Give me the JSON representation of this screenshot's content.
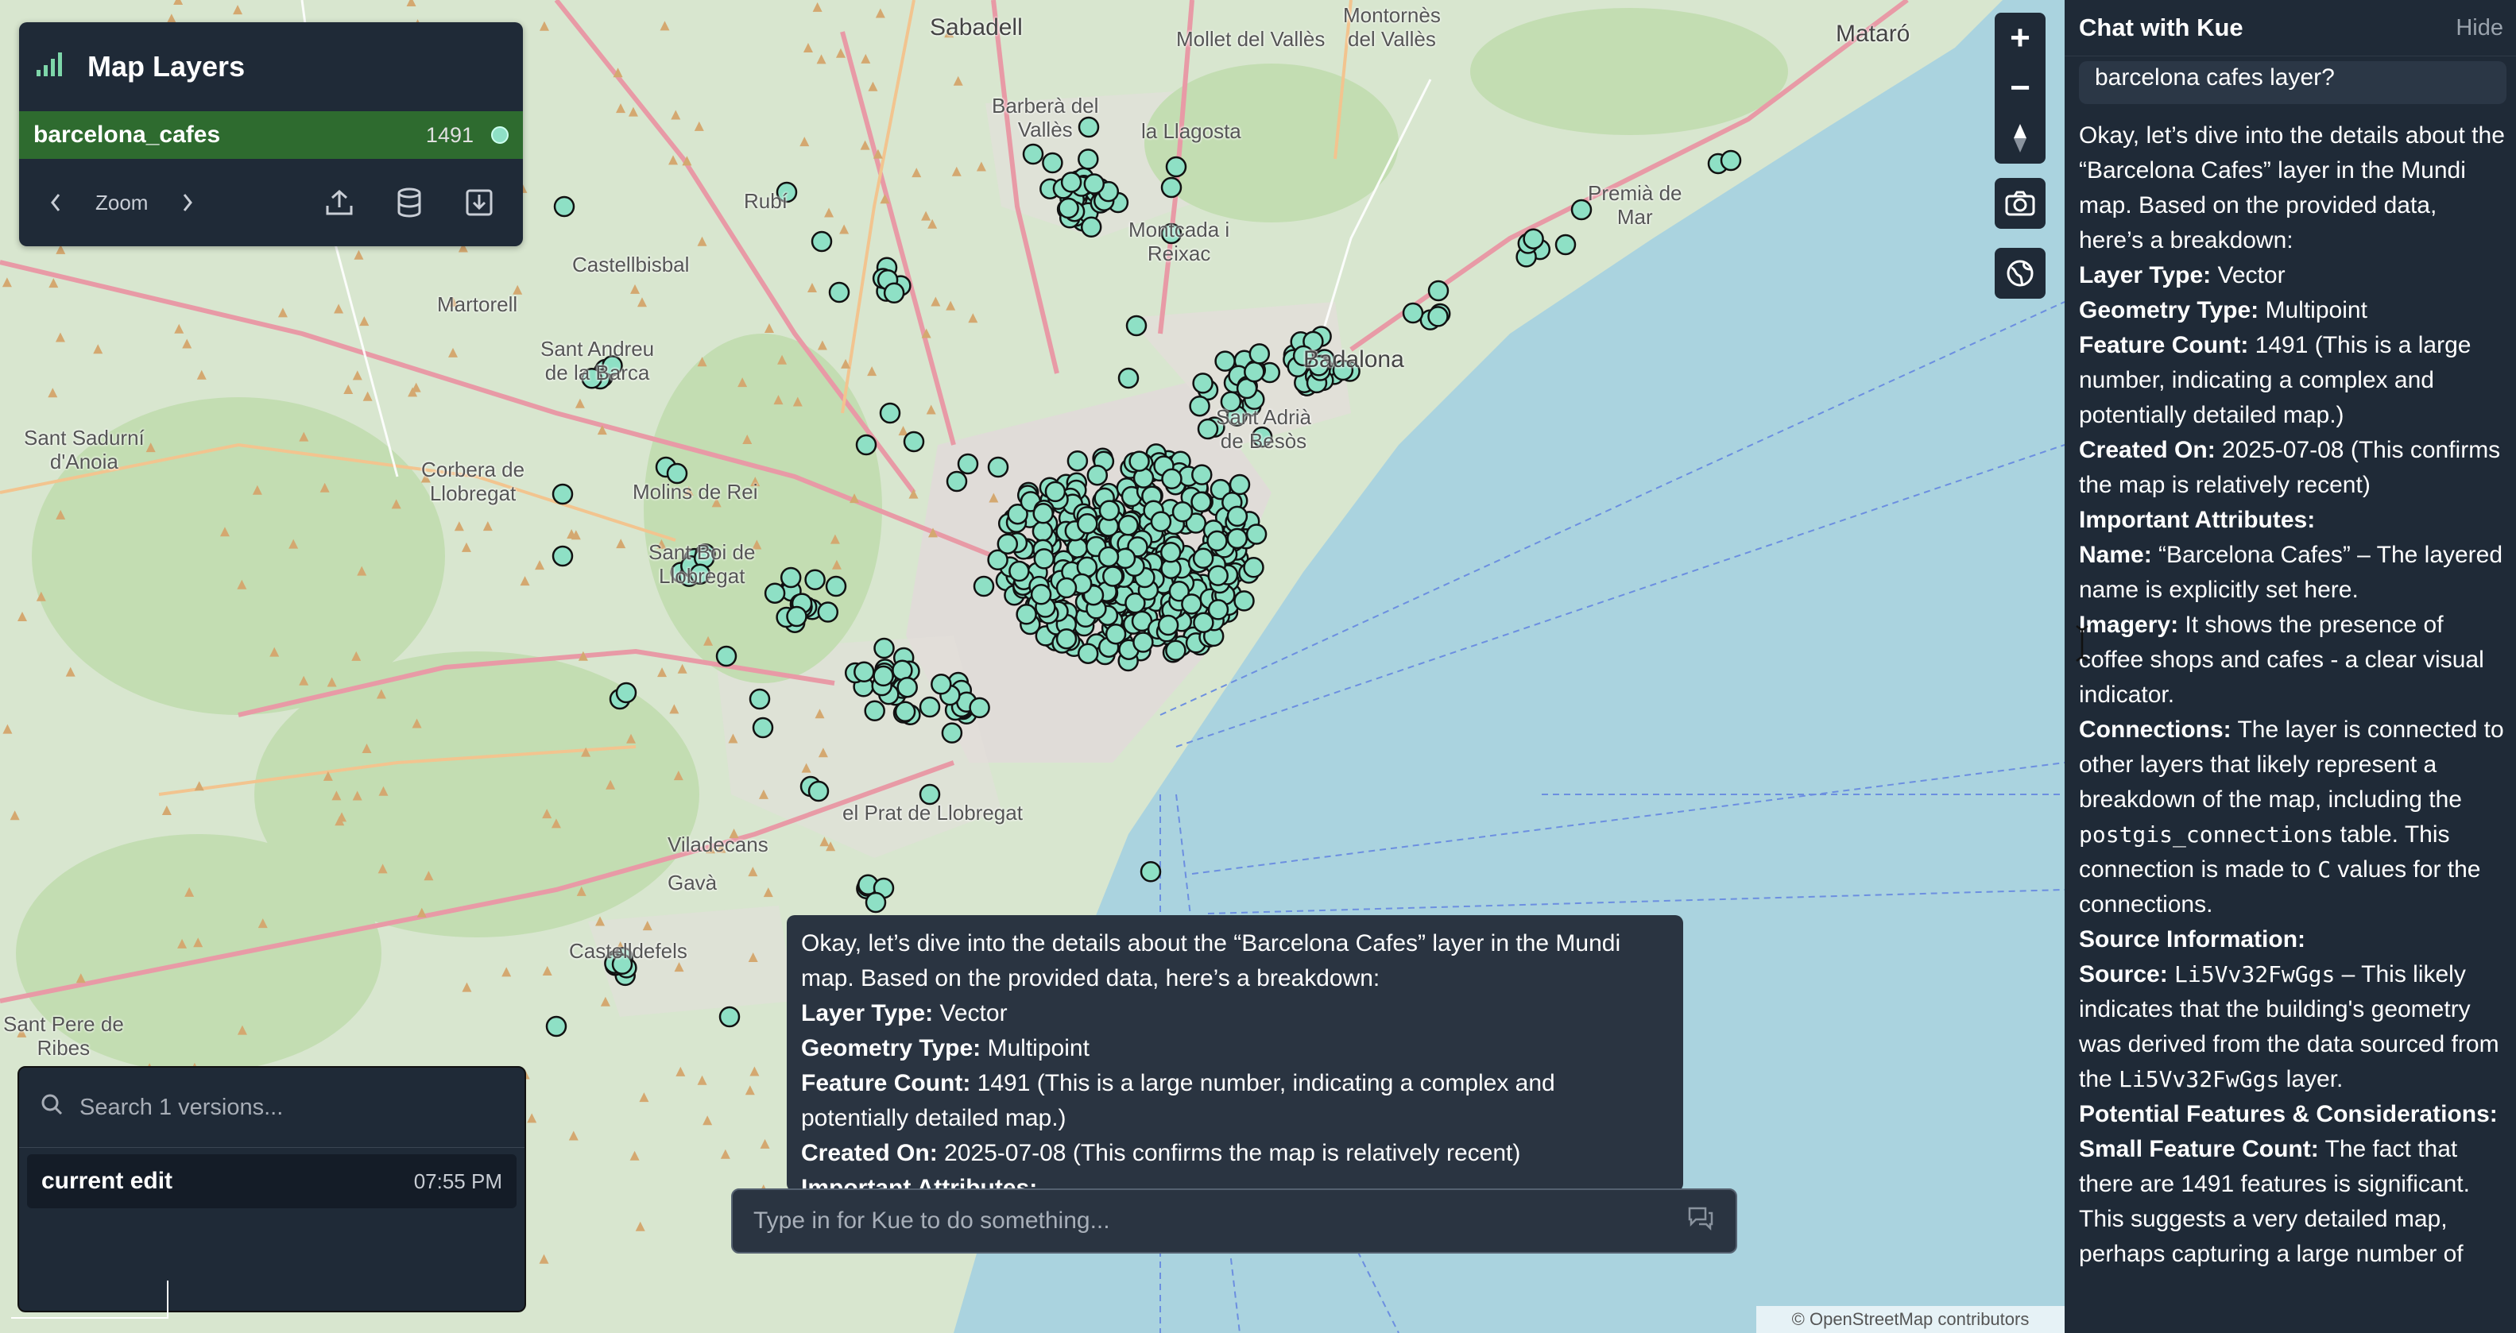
{
  "map": {
    "places": [
      {
        "name": "Sabadell"
      },
      {
        "name": "Montornès\ndel Vallès"
      },
      {
        "name": "Mollet del Vallès"
      },
      {
        "name": "Mataró"
      },
      {
        "name": "Barberà del\nVallès"
      },
      {
        "name": "la Llagosta"
      },
      {
        "name": "Rubí"
      },
      {
        "name": "Montcada i\nReixac"
      },
      {
        "name": "Premià de\nMar"
      },
      {
        "name": "Martorell"
      },
      {
        "name": "Castellbisbal"
      },
      {
        "name": "Sant Andreu\nde la Barca"
      },
      {
        "name": "Badalona"
      },
      {
        "name": "Sant Adrià\nde Besòs"
      },
      {
        "name": "Sant Sadurní\nd'Anoia"
      },
      {
        "name": "Corbera de\nLlobregat"
      },
      {
        "name": "Molins de Rei"
      },
      {
        "name": "Sant Boi de\nLlobregat"
      },
      {
        "name": "Viladecans"
      },
      {
        "name": "el Prat de Llobregat"
      },
      {
        "name": "Gavà"
      },
      {
        "name": "Castelldefels"
      },
      {
        "name": "Sant Pere de\nRibes"
      }
    ],
    "marker_color": "#8ee0c5",
    "attribution": "© OpenStreetMap contributors"
  },
  "layers_panel": {
    "title": "Map Layers",
    "layer": {
      "name": "barcelona_cafes",
      "count": "1491",
      "color": "#2e6b2f"
    },
    "zoom_label": "Zoom"
  },
  "map_controls": {
    "zoom_in": "+",
    "zoom_out": "−"
  },
  "versions": {
    "search_placeholder": "Search 1 versions...",
    "items": [
      {
        "label": "current edit",
        "time": "07:55 PM"
      }
    ]
  },
  "popup": {
    "intro": "Okay, let’s dive into the details about the “Barcelona Cafes” layer in the Mundi map. Based on the provided data, here’s a breakdown:",
    "rows": [
      {
        "key": "Layer Type:",
        "val": " Vector"
      },
      {
        "key": "Geometry Type:",
        "val": " Multipoint"
      },
      {
        "key": "Feature Count:",
        "val": " 1491 (This is a large number, indicating a complex and potentially detailed map.)"
      },
      {
        "key": "Created On:",
        "val": " 2025-07-08 (This confirms the map is relatively recent)"
      },
      {
        "key": "Important Attributes:",
        "val": ""
      }
    ]
  },
  "prompt": {
    "placeholder": "Type in for Kue to do something..."
  },
  "chat": {
    "title": "Chat with Kue",
    "hide_label": "Hide",
    "user_message": "barcelona cafes layer?",
    "intro": "Okay, let’s dive into the details about the “Barcelona Cafes” layer in the Mundi map. Based on the provided data, here’s a breakdown:",
    "layer_type_key": "Layer Type:",
    "layer_type_val": " Vector",
    "geometry_key": "Geometry Type:",
    "geometry_val": " Multipoint",
    "feature_key": "Feature Count:",
    "feature_val": " 1491 (This is a large number, indicating a complex and potentially detailed map.)",
    "created_key": "Created On:",
    "created_val": " 2025-07-08 (This confirms the map is relatively recent)",
    "attributes_key": "Important Attributes:",
    "name_key": "Name:",
    "name_val": " “Barcelona Cafes” – The layered name is explicitly set here.",
    "imagery_key": "Imagery:",
    "imagery_val": " It shows the presence of coffee shops and cafes - a clear visual indicator.",
    "connections_key": "Connections:",
    "connections_val_1": " The layer is connected to other layers that likely represent a breakdown of the map, including the ",
    "connections_code": "postgis_connections",
    "connections_val_2": " table. This connection is made to ",
    "connections_code_2": "C",
    "connections_val_3": " values for the connections.",
    "source_info_key": "Source Information:",
    "source_key": "Source:",
    "source_code": "Li5Vv32FwGgs",
    "source_val_1": " – This likely indicates that the building's geometry was derived from the data sourced from the ",
    "source_code_2": "Li5Vv32FwGgs",
    "source_val_2": " layer.",
    "potential_key": "Potential Features & Considerations:",
    "small_key": "Small Feature Count:",
    "small_val": " The fact that there are 1491 features is significant. This suggests a very detailed map, perhaps capturing a large number of"
  }
}
